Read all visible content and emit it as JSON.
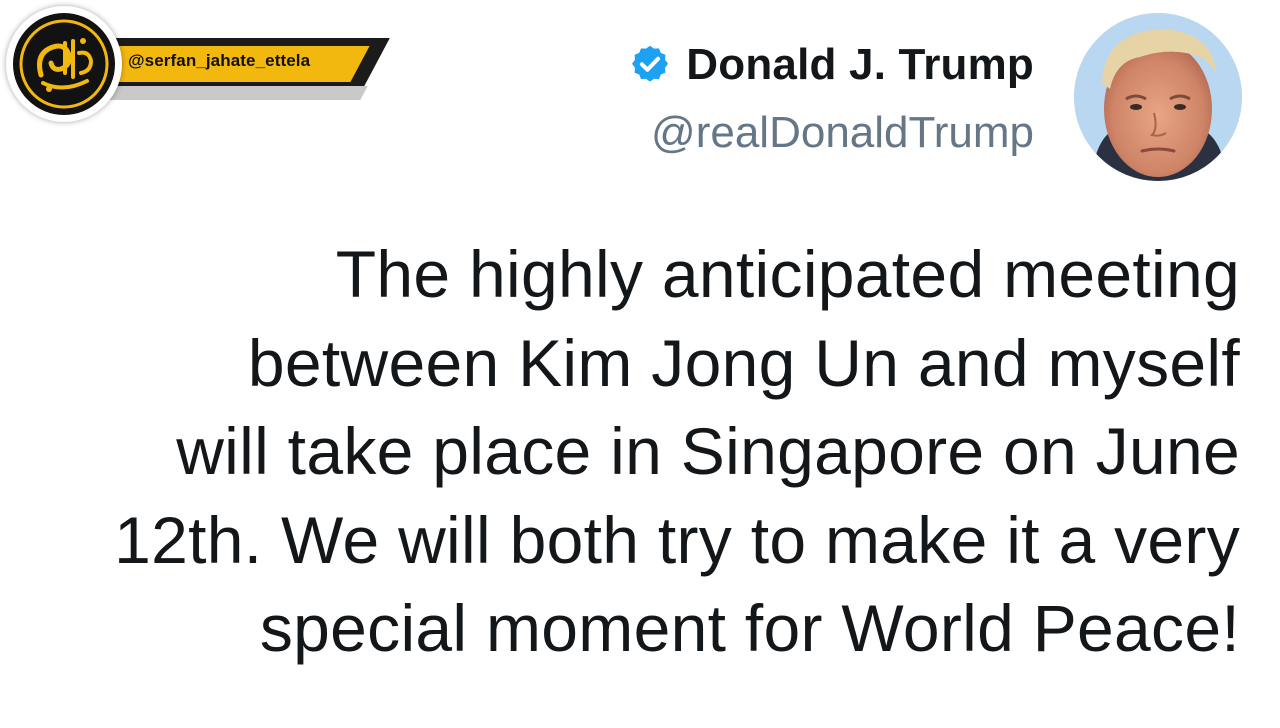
{
  "channel": {
    "handle": "@serfan_jahate_ettela",
    "logo_icon": "channel-logo-icon",
    "colors": {
      "accent": "#f3b80e",
      "dark": "#1b1b1b"
    }
  },
  "tweet": {
    "author": {
      "name": "Donald J. Trump",
      "username": "@realDonaldTrump",
      "verified_icon": "verified-badge-icon",
      "avatar_icon": "profile-photo"
    },
    "text_lines": [
      "The highly anticipated meeting",
      "between Kim Jong Un and myself",
      "will take place in Singapore on June",
      "12th. We will both try to make it a very",
      "special moment for World Peace!"
    ],
    "colors": {
      "verified": "#1da1f2",
      "text": "#14171a",
      "secondary": "#657786"
    }
  }
}
